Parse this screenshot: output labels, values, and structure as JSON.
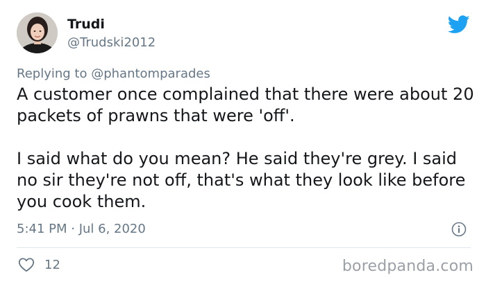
{
  "user": {
    "display_name": "Trudi",
    "handle": "@Trudski2012"
  },
  "reply": {
    "prefix": "Replying to",
    "mention": "@phantomparades"
  },
  "tweet": {
    "paragraphs": [
      "A customer once complained that there were about 20 packets of prawns that were 'off'.",
      "I said what do you mean? He said they're grey. I said no sir they're not off, that's what they look like before you cook them."
    ],
    "timestamp": "5:41 PM · Jul 6, 2020",
    "like_count": "12"
  },
  "icons": {
    "brand": "twitter-bird-icon",
    "info": "info-icon",
    "like": "heart-icon"
  },
  "colors": {
    "twitter_blue": "#1DA1F2",
    "secondary_text": "#657786",
    "primary_text": "#14171A"
  },
  "watermark": "boredpanda.com"
}
